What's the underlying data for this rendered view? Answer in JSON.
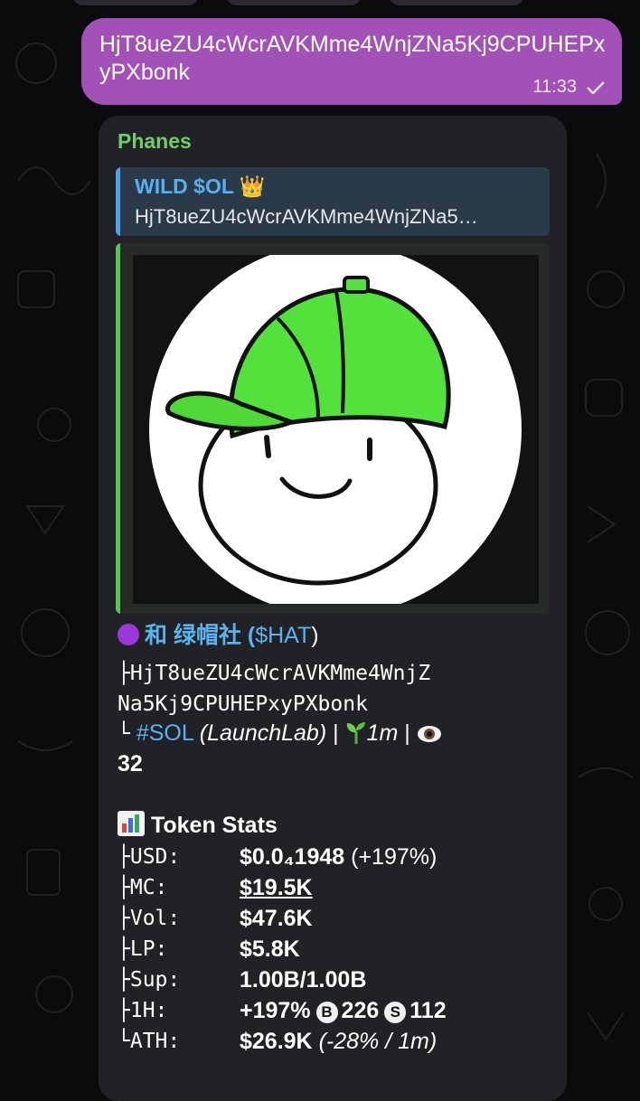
{
  "outgoing": {
    "text": "HjT8ueZU4cWcrAVKMme4WnjZNa5Kj9CPUHEPxyPXbonk",
    "time": "11:33"
  },
  "incoming": {
    "sender": "Phanes",
    "reply": {
      "title": "WILD $OL 👑",
      "text": "HjT8ueZU4cWcrAVKMme4WnjZNa5…"
    },
    "token": {
      "name_prefix": "和  绿帽社 (",
      "ticker": "$HAT",
      "name_suffix": ")",
      "address_line1": "├HjT8ueZU4cWcrAVKMme4WnjZ",
      "address_line2": "Na5Kj9CPUHEPxyPXbonk",
      "branch": "└",
      "chain_tag": "#SOL",
      "platform": "(LaunchLab)",
      "sep1": " | ",
      "age": "1m",
      "sep2": " | ",
      "views": "32"
    },
    "stats_title": "Token Stats",
    "stats": [
      {
        "key": "├USD:",
        "value": "$0.0₄1948",
        "extra": " (+197%)"
      },
      {
        "key": "├MC:",
        "value": "$19.5K"
      },
      {
        "key": "├Vol:",
        "value": "$47.6K"
      },
      {
        "key": "├LP:",
        "value": "$5.8K"
      },
      {
        "key": "├Sup:",
        "value": "1.00B/1.00B"
      },
      {
        "key": "├1H:",
        "value": "+197%",
        "buys_icon": "B",
        "buys": "226",
        "sells_icon": "S",
        "sells": "112"
      },
      {
        "key": "└ATH:",
        "value": "$26.9K",
        "extra": " (-28% / 1m)"
      }
    ]
  },
  "colors": {
    "outgoing_bubble": "#a251b6",
    "incoming_bubble": "#212225",
    "sender": "#6fce66",
    "link": "#5ab3f0",
    "hat_green": "#4fe03a"
  },
  "icons": [
    "check-icon",
    "crown-icon",
    "purple-circle-icon",
    "sprout-icon",
    "eye-icon",
    "bar-chart-icon",
    "bitcoin-b-icon",
    "s-coin-icon"
  ]
}
